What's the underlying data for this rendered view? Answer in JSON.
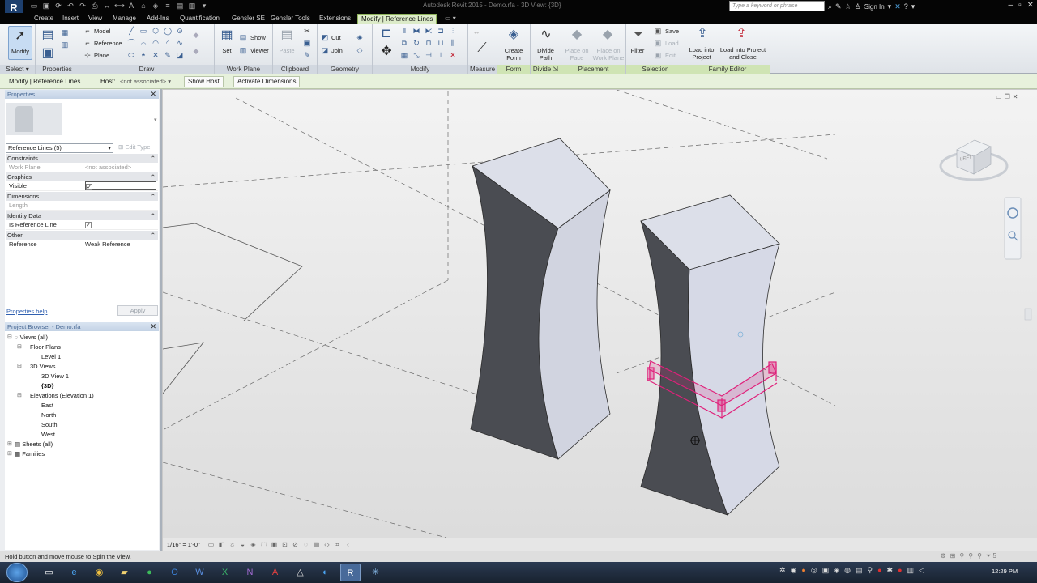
{
  "titlebar": {
    "app_logo": "R",
    "window_title": "Autodesk Revit 2015 -    Demo.rfa - 3D View: {3D}",
    "search_placeholder": "Type a keyword or phrase",
    "sign_in": "Sign In"
  },
  "tabs": [
    "Create",
    "Insert",
    "View",
    "Manage",
    "Add-Ins",
    "Quantification",
    "Gensler SE",
    "Gensler Tools",
    "Extensions",
    "Modify | Reference Lines"
  ],
  "ribbon": {
    "modify": "Modify",
    "draw_items": [
      "Model",
      "Reference",
      "Plane"
    ],
    "workplane_items": [
      "Set",
      "Show",
      "Viewer"
    ],
    "clipboard_paste": "Paste",
    "geometry_items": [
      "Cut",
      "Join"
    ],
    "create_form": "Create Form",
    "divide_path": "Divide Path",
    "place_on_face": "Place on Face",
    "place_on_work_plane": "Place on Work Plane",
    "filter": "Filter",
    "save": "Save",
    "load": "Load",
    "edit": "Edit",
    "load_into_project": "Load into Project",
    "load_into_project_close": "Load into Project and Close",
    "panels": {
      "select": "Select",
      "properties": "Properties",
      "draw": "Draw",
      "work_plane": "Work Plane",
      "clipboard": "Clipboard",
      "geometry": "Geometry",
      "modify": "Modify",
      "measure": "Measure",
      "form": "Form",
      "divide": "Divide",
      "placement": "Placement",
      "selection": "Selection",
      "family_editor": "Family Editor"
    }
  },
  "options_bar": {
    "context": "Modify | Reference Lines",
    "host_label": "Host:",
    "host_value": "<not associated>",
    "show_host": "Show Host",
    "activate_dimensions": "Activate Dimensions"
  },
  "properties": {
    "title": "Properties",
    "type_selector": "Reference Lines (5)",
    "edit_type": "Edit Type",
    "groups": {
      "constraints": "Constraints",
      "graphics": "Graphics",
      "dimensions": "Dimensions",
      "identity_data": "Identity Data",
      "other": "Other"
    },
    "rows": {
      "work_plane": {
        "key": "Work Plane",
        "value": "<not associated>"
      },
      "visible": {
        "key": "Visible",
        "value": "✓"
      },
      "length": {
        "key": "Length",
        "value": ""
      },
      "is_reference_line": {
        "key": "Is Reference Line",
        "value": "✓"
      },
      "reference": {
        "key": "Reference",
        "value": "Weak Reference"
      }
    },
    "help_link": "Properties help",
    "apply": "Apply"
  },
  "project_browser": {
    "title": "Project Browser - Demo.rfa",
    "items": {
      "views_all": "Views (all)",
      "floor_plans": "Floor Plans",
      "level_1": "Level 1",
      "views_3d": "3D Views",
      "view_3d_1": "3D View 1",
      "view_3d_current": "{3D}",
      "elevations": "Elevations (Elevation 1)",
      "east": "East",
      "north": "North",
      "south": "South",
      "west": "West",
      "sheets": "Sheets (all)",
      "families": "Families"
    }
  },
  "viewcube": {
    "face_label": "LEFT"
  },
  "view_bar": {
    "scale": "1/16\" = 1'-0\""
  },
  "status_bar": {
    "text": "Hold button and move mouse to Spin the View.",
    "filter_count": ":5"
  },
  "taskbar": {
    "clock": "12:29 PM"
  },
  "colors": {
    "ribbon_context": "#dcebc8",
    "selection": "#e0207a",
    "mass_dark": "#4a4c52",
    "mass_light": "#d6d9e6"
  }
}
